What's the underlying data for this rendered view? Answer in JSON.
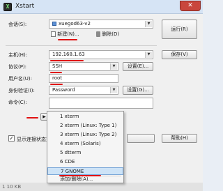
{
  "window": {
    "title": "Xstart",
    "close_label": "✕"
  },
  "session": {
    "label": "会话(S):",
    "value": "xuegod63-v2",
    "new_label": "新建(N)...",
    "delete_label": "删除(D)",
    "run_label": "运行(R)"
  },
  "host": {
    "label": "主机(H):",
    "value": "192.168.1.63",
    "save_label": "保存(V)"
  },
  "protocol": {
    "label": "协议(P):",
    "value": "SSH",
    "settings_label": "设置(E)..."
  },
  "username": {
    "label": "用户名(U):",
    "value": "root"
  },
  "auth": {
    "label": "身份验证(I):",
    "value": "Password",
    "settings_label": "设置(G)..."
  },
  "command": {
    "label": "命令(C):",
    "menu_button_label": "▶"
  },
  "show_status": {
    "label": "显示连接状态对"
  },
  "help_label": "帮助(H)",
  "menu": {
    "items": [
      "1 xterm",
      "2 xterm (Linux: Type 1)",
      "3 xterm (Linux: Type 2)",
      "4 xterm (Solaris)",
      "5 dtterm",
      "6 CDE",
      "7 GNOME"
    ],
    "add_remove_label": "添加/删除(A)..."
  },
  "statusbar": {
    "text": "1 10 KB"
  },
  "colors": {
    "annotation": "#e01010",
    "menu_highlight": "#cde3f7"
  }
}
